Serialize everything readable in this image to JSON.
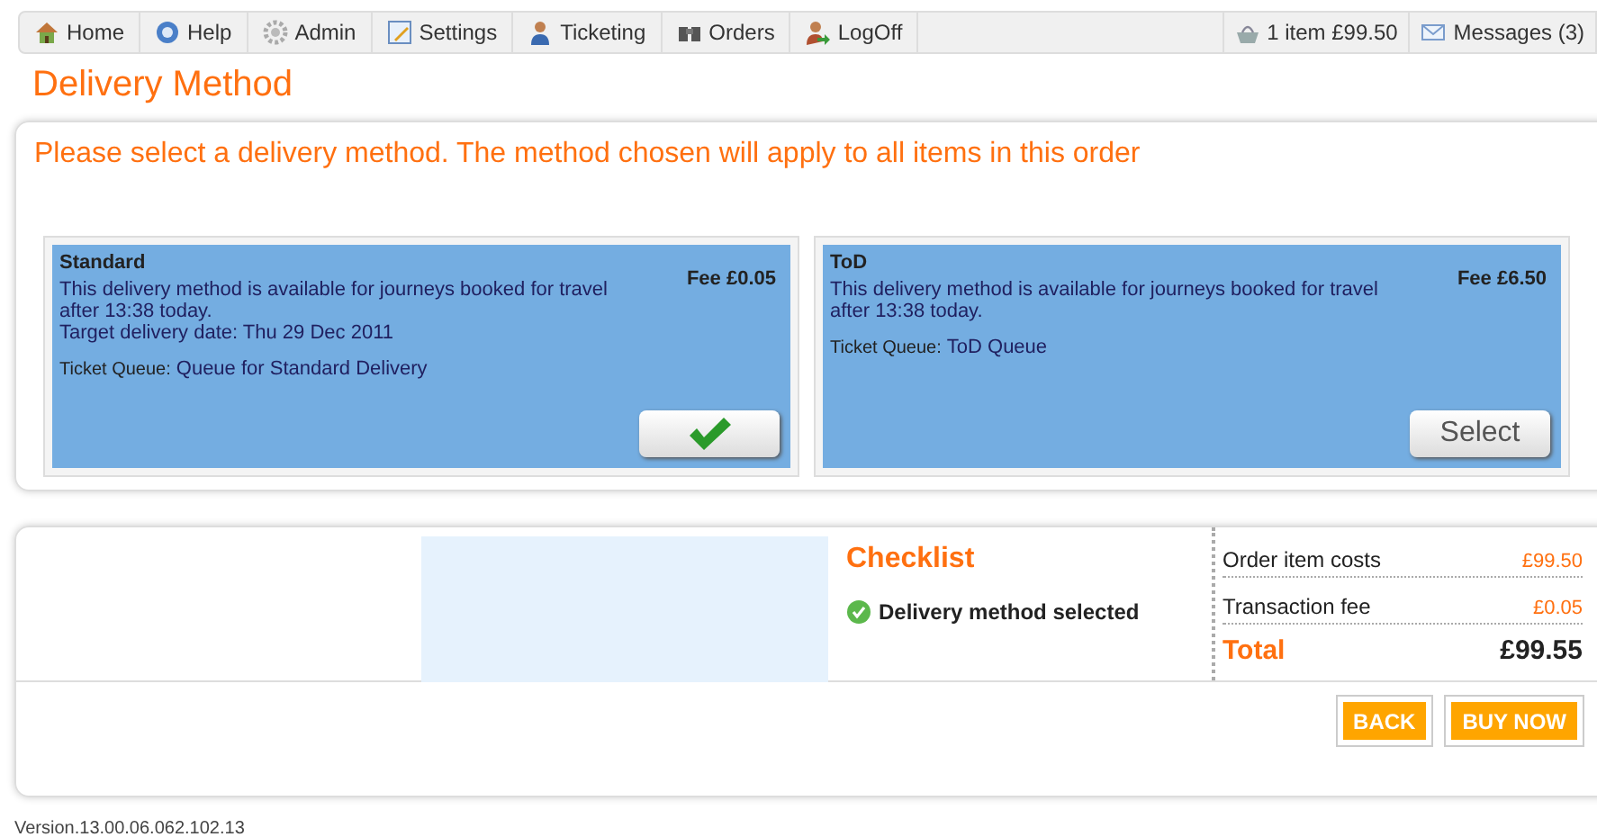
{
  "nav": {
    "items": [
      {
        "label": "Home",
        "kind": "home"
      },
      {
        "label": "Help",
        "kind": "help"
      },
      {
        "label": "Admin",
        "kind": "gear"
      },
      {
        "label": "Settings",
        "kind": "pencil"
      },
      {
        "label": "Ticketing",
        "kind": "person"
      },
      {
        "label": "Orders",
        "kind": "binoculars"
      },
      {
        "label": "LogOff",
        "kind": "logoff"
      }
    ],
    "right": [
      {
        "label": "1 item £99.50",
        "kind": "basket"
      },
      {
        "label": "Messages (3)",
        "kind": "envelope"
      }
    ]
  },
  "title": "Delivery Method",
  "instruction": "Please select a delivery method. The method chosen will apply to all items in this order",
  "methods": [
    {
      "name": "Standard",
      "fee": "Fee £0.05",
      "lines": [
        "This delivery method is available for journeys booked for travel after 13:38 today.",
        "Target delivery date: Thu 29 Dec 2011"
      ],
      "queue_label": "Ticket Queue:",
      "queue": "Queue for Standard Delivery",
      "selected": true
    },
    {
      "name": "ToD",
      "fee": "Fee £6.50",
      "lines": [
        "This delivery method is available for journeys booked for travel after 13:38 today."
      ],
      "queue_label": "Ticket Queue:",
      "queue": "ToD Queue",
      "selected": false,
      "button_label": "Select"
    }
  ],
  "checklist": {
    "title": "Checklist",
    "items": [
      {
        "label": "Delivery method selected",
        "done": true
      }
    ]
  },
  "costs": [
    {
      "label": "Order item costs",
      "value": "£99.50"
    },
    {
      "label": "Transaction fee",
      "value": "£0.05"
    }
  ],
  "total": {
    "label": "Total",
    "value": "£99.55"
  },
  "buttons": [
    "BACK",
    "BUY NOW"
  ],
  "version": "Version.13.00.06.062.102.13"
}
